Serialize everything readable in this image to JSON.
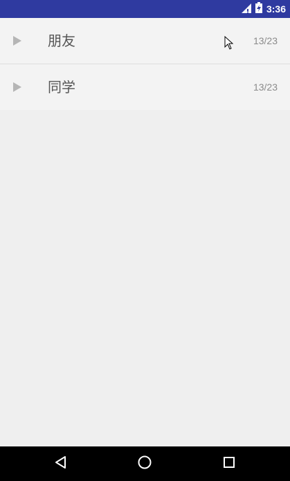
{
  "status_bar": {
    "time": "3:36",
    "background_color": "#2f3aa0",
    "icons": [
      "signal-icon",
      "battery-icon"
    ]
  },
  "groups": [
    {
      "name": "朋友",
      "count": "13/23",
      "expanded": false
    },
    {
      "name": "同学",
      "count": "13/23",
      "expanded": false
    }
  ],
  "nav_bar": {
    "icons": [
      "back-icon",
      "home-icon",
      "recent-apps-icon"
    ]
  }
}
